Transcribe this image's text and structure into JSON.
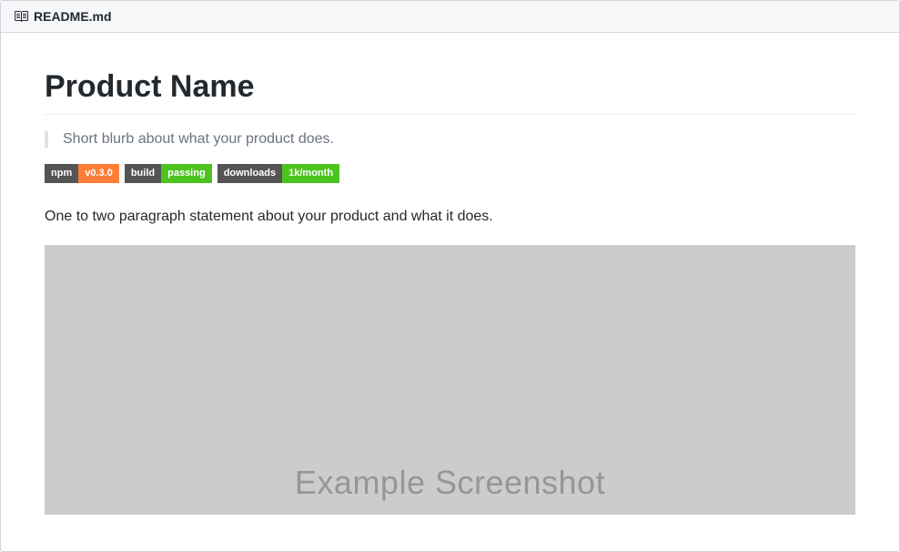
{
  "header": {
    "filename": "README.md"
  },
  "content": {
    "title": "Product Name",
    "blurb": "Short blurb about what your product does.",
    "description": "One to two paragraph statement about your product and what it does.",
    "screenshot_label": "Example Screenshot"
  },
  "badges": [
    {
      "left": "npm",
      "right": "v0.3.0",
      "color": "orange"
    },
    {
      "left": "build",
      "right": "passing",
      "color": "green"
    },
    {
      "left": "downloads",
      "right": "1k/month",
      "color": "green"
    }
  ]
}
